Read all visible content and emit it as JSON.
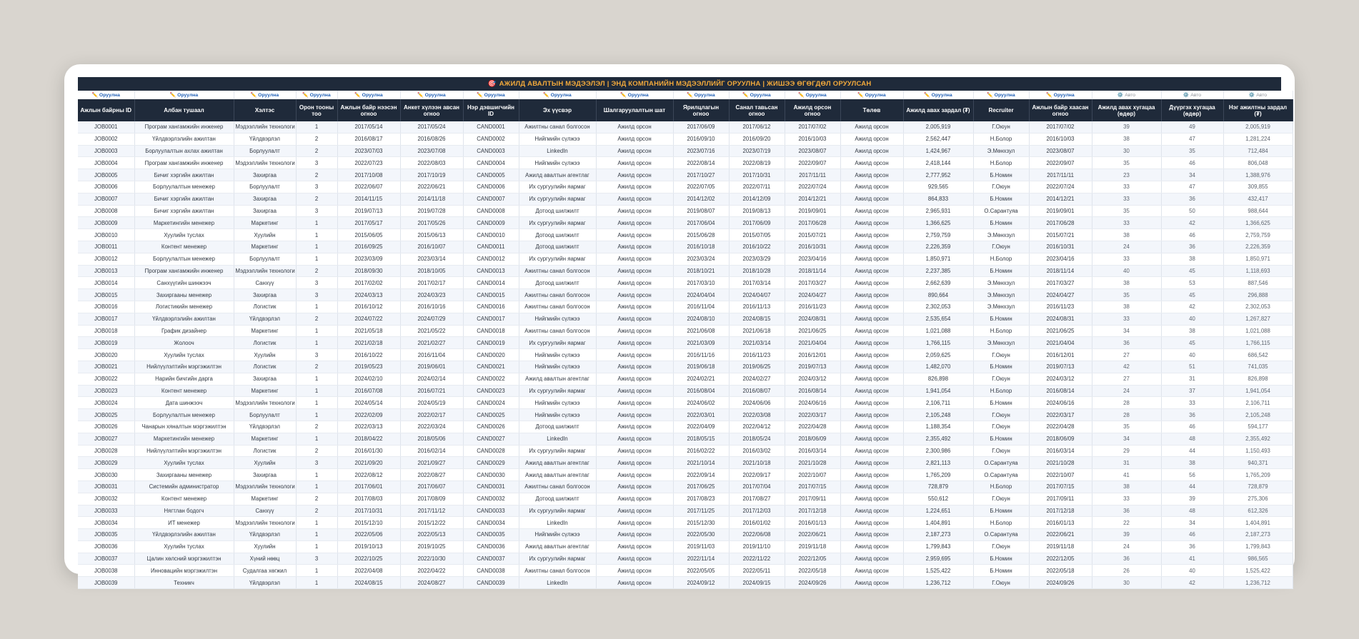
{
  "sheet": {
    "title": "АЖИЛД АВАЛТЫН МЭДЭЭЛЭЛ  |  ЭНД КОМПАНИЙН МЭДЭЭЛЛИЙГ ОРУУЛНА  |  ЖИШЭЭ ӨГӨГДӨЛ ОРУУЛСАН",
    "title_icon": "🎯",
    "input_marker": "✏️ Оруулна",
    "auto_marker": "⚙️ Авто",
    "colors": {
      "header_bg": "#1f2a3a",
      "title_text": "#f2a93b",
      "input_marker": "#1f5fb5",
      "row_stripe": "#f3f6fb"
    }
  },
  "columns": [
    {
      "label": "Ажлын байрны ID",
      "marker": "input",
      "w": 79
    },
    {
      "label": "Албан тушаал",
      "marker": "input",
      "w": 139
    },
    {
      "label": "Хэлтэс",
      "marker": "input",
      "w": 87
    },
    {
      "label": "Орон тооны тоо",
      "marker": "input",
      "w": 58
    },
    {
      "label": "Ажлын байр нээсэн огноо",
      "marker": "input",
      "w": 88
    },
    {
      "label": "Анкет хүлээн авсан огноо",
      "marker": "input",
      "w": 88
    },
    {
      "label": "Нэр дэвшигчийн ID",
      "marker": "input",
      "w": 78
    },
    {
      "label": "Эх үүсвэр",
      "marker": "input",
      "w": 108
    },
    {
      "label": "Шалгаруулалтын шат",
      "marker": "input",
      "w": 108
    },
    {
      "label": "Ярилцлагын огноо",
      "marker": "input",
      "w": 78
    },
    {
      "label": "Санал тавьсан огноо",
      "marker": "input",
      "w": 78
    },
    {
      "label": "Ажилд орсон огноо",
      "marker": "input",
      "w": 78
    },
    {
      "label": "Төлөв",
      "marker": "input",
      "w": 88
    },
    {
      "label": "Ажилд авах зардал (₮)",
      "marker": "input",
      "w": 98
    },
    {
      "label": "Recruiter",
      "marker": "input",
      "w": 78
    },
    {
      "label": "Ажлын байр хаасан огноо",
      "marker": "input",
      "w": 88
    },
    {
      "label": "Ажилд авах хугацаа (өдөр)",
      "marker": "auto",
      "w": 97
    },
    {
      "label": "Дүүргэх хугацаа (өдөр)",
      "marker": "auto",
      "w": 87
    },
    {
      "label": "Нэг ажилтны зардал (₮)",
      "marker": "auto",
      "w": 97
    }
  ],
  "rows": [
    [
      "JOB0001",
      "Програм хангамжийн инженер",
      "Мэдээллийн технологи",
      "1",
      "2017/05/14",
      "2017/05/24",
      "CAND0001",
      "Ажилтны санал болгосон",
      "Ажилд орсон",
      "2017/06/09",
      "2017/06/12",
      "2017/07/02",
      "Ажилд орсон",
      "2,005,919",
      "Г.Оюун",
      "2017/07/02",
      "39",
      "49",
      "2,005,919"
    ],
    [
      "JOB0002",
      "Үйлдвэрлэлийн ажилтан",
      "Үйлдвэрлэл",
      "2",
      "2016/08/17",
      "2016/08/26",
      "CAND0002",
      "Нийгмийн сүлжээ",
      "Ажилд орсон",
      "2016/09/10",
      "2016/09/20",
      "2016/10/03",
      "Ажилд орсон",
      "2,562,447",
      "Н.Болор",
      "2016/10/03",
      "38",
      "47",
      "1,281,224"
    ],
    [
      "JOB0003",
      "Борлуулалтын ахлах ажилтан",
      "Борлуулалт",
      "2",
      "2023/07/03",
      "2023/07/08",
      "CAND0003",
      "LinkedIn",
      "Ажилд орсон",
      "2023/07/16",
      "2023/07/19",
      "2023/08/07",
      "Ажилд орсон",
      "1,424,967",
      "Э.Мөнхзул",
      "2023/08/07",
      "30",
      "35",
      "712,484"
    ],
    [
      "JOB0004",
      "Програм хангамжийн инженер",
      "Мэдээллийн технологи",
      "3",
      "2022/07/23",
      "2022/08/03",
      "CAND0004",
      "Нийгмийн сүлжээ",
      "Ажилд орсон",
      "2022/08/14",
      "2022/08/19",
      "2022/09/07",
      "Ажилд орсон",
      "2,418,144",
      "Н.Болор",
      "2022/09/07",
      "35",
      "46",
      "806,048"
    ],
    [
      "JOB0005",
      "Бичиг хэргийн ажилтан",
      "Захиргаа",
      "2",
      "2017/10/08",
      "2017/10/19",
      "CAND0005",
      "Ажилд авалтын агентлаг",
      "Ажилд орсон",
      "2017/10/27",
      "2017/10/31",
      "2017/11/11",
      "Ажилд орсон",
      "2,777,952",
      "Б.Номин",
      "2017/11/11",
      "23",
      "34",
      "1,388,976"
    ],
    [
      "JOB0006",
      "Борлуулалтын менежер",
      "Борлуулалт",
      "3",
      "2022/06/07",
      "2022/06/21",
      "CAND0006",
      "Их сургуулийн яармаг",
      "Ажилд орсон",
      "2022/07/05",
      "2022/07/11",
      "2022/07/24",
      "Ажилд орсон",
      "929,565",
      "Г.Оюун",
      "2022/07/24",
      "33",
      "47",
      "309,855"
    ],
    [
      "JOB0007",
      "Бичиг хэргийн ажилтан",
      "Захиргаа",
      "2",
      "2014/11/15",
      "2014/11/18",
      "CAND0007",
      "Их сургуулийн яармаг",
      "Ажилд орсон",
      "2014/12/02",
      "2014/12/09",
      "2014/12/21",
      "Ажилд орсон",
      "864,833",
      "Б.Номин",
      "2014/12/21",
      "33",
      "36",
      "432,417"
    ],
    [
      "JOB0008",
      "Бичиг хэргийн ажилтан",
      "Захиргаа",
      "3",
      "2019/07/13",
      "2019/07/28",
      "CAND0008",
      "Дотоод шилжилт",
      "Ажилд орсон",
      "2019/08/07",
      "2019/08/13",
      "2019/09/01",
      "Ажилд орсон",
      "2,965,931",
      "О.Сарантуяа",
      "2019/09/01",
      "35",
      "50",
      "988,644"
    ],
    [
      "JOB0009",
      "Маркетингийн менежер",
      "Маркетинг",
      "1",
      "2017/05/17",
      "2017/05/26",
      "CAND0009",
      "Их сургуулийн яармаг",
      "Ажилд орсон",
      "2017/06/04",
      "2017/06/09",
      "2017/06/28",
      "Ажилд орсон",
      "1,366,625",
      "Б.Номин",
      "2017/06/28",
      "33",
      "42",
      "1,366,625"
    ],
    [
      "JOB0010",
      "Хуулийн туслах",
      "Хуулийн",
      "1",
      "2015/06/05",
      "2015/06/13",
      "CAND0010",
      "Дотоод шилжилт",
      "Ажилд орсон",
      "2015/06/28",
      "2015/07/05",
      "2015/07/21",
      "Ажилд орсон",
      "2,759,759",
      "Э.Мөнхзул",
      "2015/07/21",
      "38",
      "46",
      "2,759,759"
    ],
    [
      "JOB0011",
      "Контент менежер",
      "Маркетинг",
      "1",
      "2016/09/25",
      "2016/10/07",
      "CAND0011",
      "Дотоод шилжилт",
      "Ажилд орсон",
      "2016/10/18",
      "2016/10/22",
      "2016/10/31",
      "Ажилд орсон",
      "2,226,359",
      "Г.Оюун",
      "2016/10/31",
      "24",
      "36",
      "2,226,359"
    ],
    [
      "JOB0012",
      "Борлуулалтын менежер",
      "Борлуулалт",
      "1",
      "2023/03/09",
      "2023/03/14",
      "CAND0012",
      "Их сургуулийн яармаг",
      "Ажилд орсон",
      "2023/03/24",
      "2023/03/29",
      "2023/04/16",
      "Ажилд орсон",
      "1,850,971",
      "Н.Болор",
      "2023/04/16",
      "33",
      "38",
      "1,850,971"
    ],
    [
      "JOB0013",
      "Програм хангамжийн инженер",
      "Мэдээллийн технологи",
      "2",
      "2018/09/30",
      "2018/10/05",
      "CAND0013",
      "Ажилтны санал болгосон",
      "Ажилд орсон",
      "2018/10/21",
      "2018/10/28",
      "2018/11/14",
      "Ажилд орсон",
      "2,237,385",
      "Б.Номин",
      "2018/11/14",
      "40",
      "45",
      "1,118,693"
    ],
    [
      "JOB0014",
      "Санхүүгийн шинжээч",
      "Санхүү",
      "3",
      "2017/02/02",
      "2017/02/17",
      "CAND0014",
      "Дотоод шилжилт",
      "Ажилд орсон",
      "2017/03/10",
      "2017/03/14",
      "2017/03/27",
      "Ажилд орсон",
      "2,662,639",
      "Э.Мөнхзул",
      "2017/03/27",
      "38",
      "53",
      "887,546"
    ],
    [
      "JOB0015",
      "Захиргааны менежер",
      "Захиргаа",
      "3",
      "2024/03/13",
      "2024/03/23",
      "CAND0015",
      "Ажилтны санал болгосон",
      "Ажилд орсон",
      "2024/04/04",
      "2024/04/07",
      "2024/04/27",
      "Ажилд орсон",
      "890,664",
      "Э.Мөнхзул",
      "2024/04/27",
      "35",
      "45",
      "296,888"
    ],
    [
      "JOB0016",
      "Логистикийн менежер",
      "Логистик",
      "1",
      "2016/10/12",
      "2016/10/16",
      "CAND0016",
      "Ажилтны санал болгосон",
      "Ажилд орсон",
      "2016/11/04",
      "2016/11/13",
      "2016/11/23",
      "Ажилд орсон",
      "2,302,053",
      "Э.Мөнхзул",
      "2016/11/23",
      "38",
      "42",
      "2,302,053"
    ],
    [
      "JOB0017",
      "Үйлдвэрлэлийн ажилтан",
      "Үйлдвэрлэл",
      "2",
      "2024/07/22",
      "2024/07/29",
      "CAND0017",
      "Нийгмийн сүлжээ",
      "Ажилд орсон",
      "2024/08/10",
      "2024/08/15",
      "2024/08/31",
      "Ажилд орсон",
      "2,535,654",
      "Б.Номин",
      "2024/08/31",
      "33",
      "40",
      "1,267,827"
    ],
    [
      "JOB0018",
      "График дизайнер",
      "Маркетинг",
      "1",
      "2021/05/18",
      "2021/05/22",
      "CAND0018",
      "Ажилтны санал болгосон",
      "Ажилд орсон",
      "2021/06/08",
      "2021/06/18",
      "2021/06/25",
      "Ажилд орсон",
      "1,021,088",
      "Н.Болор",
      "2021/06/25",
      "34",
      "38",
      "1,021,088"
    ],
    [
      "JOB0019",
      "Жолооч",
      "Логистик",
      "1",
      "2021/02/18",
      "2021/02/27",
      "CAND0019",
      "Их сургуулийн яармаг",
      "Ажилд орсон",
      "2021/03/09",
      "2021/03/14",
      "2021/04/04",
      "Ажилд орсон",
      "1,766,115",
      "Э.Мөнхзул",
      "2021/04/04",
      "36",
      "45",
      "1,766,115"
    ],
    [
      "JOB0020",
      "Хуулийн туслах",
      "Хуулийн",
      "3",
      "2016/10/22",
      "2016/11/04",
      "CAND0020",
      "Нийгмийн сүлжээ",
      "Ажилд орсон",
      "2016/11/16",
      "2016/11/23",
      "2016/12/01",
      "Ажилд орсон",
      "2,059,625",
      "Г.Оюун",
      "2016/12/01",
      "27",
      "40",
      "686,542"
    ],
    [
      "JOB0021",
      "Нийлүүлэлтийн мэргэжилтэн",
      "Логистик",
      "2",
      "2019/05/23",
      "2019/06/01",
      "CAND0021",
      "Нийгмийн сүлжээ",
      "Ажилд орсон",
      "2019/06/18",
      "2019/06/25",
      "2019/07/13",
      "Ажилд орсон",
      "1,482,070",
      "Б.Номин",
      "2019/07/13",
      "42",
      "51",
      "741,035"
    ],
    [
      "JOB0022",
      "Нарийн бичгийн дарга",
      "Захиргаа",
      "1",
      "2024/02/10",
      "2024/02/14",
      "CAND0022",
      "Ажилд авалтын агентлаг",
      "Ажилд орсон",
      "2024/02/21",
      "2024/02/27",
      "2024/03/12",
      "Ажилд орсон",
      "826,898",
      "Г.Оюун",
      "2024/03/12",
      "27",
      "31",
      "826,898"
    ],
    [
      "JOB0023",
      "Контент менежер",
      "Маркетинг",
      "1",
      "2016/07/08",
      "2016/07/21",
      "CAND0023",
      "Их сургуулийн яармаг",
      "Ажилд орсон",
      "2016/08/04",
      "2016/08/07",
      "2016/08/14",
      "Ажилд орсон",
      "1,941,054",
      "Н.Болор",
      "2016/08/14",
      "24",
      "37",
      "1,941,054"
    ],
    [
      "JOB0024",
      "Дата шинжээч",
      "Мэдээллийн технологи",
      "1",
      "2024/05/14",
      "2024/05/19",
      "CAND0024",
      "Нийгмийн сүлжээ",
      "Ажилд орсон",
      "2024/06/02",
      "2024/06/06",
      "2024/06/16",
      "Ажилд орсон",
      "2,106,711",
      "Б.Номин",
      "2024/06/16",
      "28",
      "33",
      "2,106,711"
    ],
    [
      "JOB0025",
      "Борлуулалтын менежер",
      "Борлуулалт",
      "1",
      "2022/02/09",
      "2022/02/17",
      "CAND0025",
      "Нийгмийн сүлжээ",
      "Ажилд орсон",
      "2022/03/01",
      "2022/03/08",
      "2022/03/17",
      "Ажилд орсон",
      "2,105,248",
      "Г.Оюун",
      "2022/03/17",
      "28",
      "36",
      "2,105,248"
    ],
    [
      "JOB0026",
      "Чанарын хяналтын мэргэжилтэн",
      "Үйлдвэрлэл",
      "2",
      "2022/03/13",
      "2022/03/24",
      "CAND0026",
      "Дотоод шилжилт",
      "Ажилд орсон",
      "2022/04/09",
      "2022/04/12",
      "2022/04/28",
      "Ажилд орсон",
      "1,188,354",
      "Г.Оюун",
      "2022/04/28",
      "35",
      "46",
      "594,177"
    ],
    [
      "JOB0027",
      "Маркетингийн менежер",
      "Маркетинг",
      "1",
      "2018/04/22",
      "2018/05/06",
      "CAND0027",
      "LinkedIn",
      "Ажилд орсон",
      "2018/05/15",
      "2018/05/24",
      "2018/06/09",
      "Ажилд орсон",
      "2,355,492",
      "Б.Номин",
      "2018/06/09",
      "34",
      "48",
      "2,355,492"
    ],
    [
      "JOB0028",
      "Нийлүүлэлтийн мэргэжилтэн",
      "Логистик",
      "2",
      "2016/01/30",
      "2016/02/14",
      "CAND0028",
      "Их сургуулийн яармаг",
      "Ажилд орсон",
      "2016/02/22",
      "2016/03/02",
      "2016/03/14",
      "Ажилд орсон",
      "2,300,986",
      "Г.Оюун",
      "2016/03/14",
      "29",
      "44",
      "1,150,493"
    ],
    [
      "JOB0029",
      "Хуулийн туслах",
      "Хуулийн",
      "3",
      "2021/09/20",
      "2021/09/27",
      "CAND0029",
      "Ажилд авалтын агентлаг",
      "Ажилд орсон",
      "2021/10/14",
      "2021/10/18",
      "2021/10/28",
      "Ажилд орсон",
      "2,821,113",
      "О.Сарантуяа",
      "2021/10/28",
      "31",
      "38",
      "940,371"
    ],
    [
      "JOB0030",
      "Захиргааны менежер",
      "Захиргаа",
      "1",
      "2022/08/12",
      "2022/08/27",
      "CAND0030",
      "Ажилд авалтын агентлаг",
      "Ажилд орсон",
      "2022/09/14",
      "2022/09/17",
      "2022/10/07",
      "Ажилд орсон",
      "1,765,209",
      "О.Сарантуяа",
      "2022/10/07",
      "41",
      "56",
      "1,765,209"
    ],
    [
      "JOB0031",
      "Системийн администратор",
      "Мэдээллийн технологи",
      "1",
      "2017/06/01",
      "2017/06/07",
      "CAND0031",
      "Ажилтны санал болгосон",
      "Ажилд орсон",
      "2017/06/25",
      "2017/07/04",
      "2017/07/15",
      "Ажилд орсон",
      "728,879",
      "Н.Болор",
      "2017/07/15",
      "38",
      "44",
      "728,879"
    ],
    [
      "JOB0032",
      "Контент менежер",
      "Маркетинг",
      "2",
      "2017/08/03",
      "2017/08/09",
      "CAND0032",
      "Дотоод шилжилт",
      "Ажилд орсон",
      "2017/08/23",
      "2017/08/27",
      "2017/09/11",
      "Ажилд орсон",
      "550,612",
      "Г.Оюун",
      "2017/09/11",
      "33",
      "39",
      "275,306"
    ],
    [
      "JOB0033",
      "Нягтлан бодогч",
      "Санхүү",
      "2",
      "2017/10/31",
      "2017/11/12",
      "CAND0033",
      "Их сургуулийн яармаг",
      "Ажилд орсон",
      "2017/11/25",
      "2017/12/03",
      "2017/12/18",
      "Ажилд орсон",
      "1,224,651",
      "Б.Номин",
      "2017/12/18",
      "36",
      "48",
      "612,326"
    ],
    [
      "JOB0034",
      "ИТ менежер",
      "Мэдээллийн технологи",
      "1",
      "2015/12/10",
      "2015/12/22",
      "CAND0034",
      "LinkedIn",
      "Ажилд орсон",
      "2015/12/30",
      "2016/01/02",
      "2016/01/13",
      "Ажилд орсон",
      "1,404,891",
      "Н.Болор",
      "2016/01/13",
      "22",
      "34",
      "1,404,891"
    ],
    [
      "JOB0035",
      "Үйлдвэрлэлийн ажилтан",
      "Үйлдвэрлэл",
      "1",
      "2022/05/06",
      "2022/05/13",
      "CAND0035",
      "Нийгмийн сүлжээ",
      "Ажилд орсон",
      "2022/05/30",
      "2022/06/08",
      "2022/06/21",
      "Ажилд орсон",
      "2,187,273",
      "О.Сарантуяа",
      "2022/06/21",
      "39",
      "46",
      "2,187,273"
    ],
    [
      "JOB0036",
      "Хуулийн туслах",
      "Хуулийн",
      "1",
      "2019/10/13",
      "2019/10/25",
      "CAND0036",
      "Ажилд авалтын агентлаг",
      "Ажилд орсон",
      "2019/11/03",
      "2019/11/10",
      "2019/11/18",
      "Ажилд орсон",
      "1,799,843",
      "Г.Оюун",
      "2019/11/18",
      "24",
      "36",
      "1,799,843"
    ],
    [
      "JOB0037",
      "Цалин хөлсний мэргэжилтэн",
      "Хүний нөөц",
      "3",
      "2022/10/25",
      "2022/10/30",
      "CAND0037",
      "Их сургуулийн яармаг",
      "Ажилд орсон",
      "2022/11/14",
      "2022/11/22",
      "2022/12/05",
      "Ажилд орсон",
      "2,959,695",
      "Б.Номин",
      "2022/12/05",
      "36",
      "41",
      "986,565"
    ],
    [
      "JOB0038",
      "Инновацийн мэргэжилтэн",
      "Судалгаа хөгжил",
      "1",
      "2022/04/08",
      "2022/04/22",
      "CAND0038",
      "Ажилтны санал болгосон",
      "Ажилд орсон",
      "2022/05/05",
      "2022/05/11",
      "2022/05/18",
      "Ажилд орсон",
      "1,525,422",
      "Б.Номин",
      "2022/05/18",
      "26",
      "40",
      "1,525,422"
    ],
    [
      "JOB0039",
      "Техникч",
      "Үйлдвэрлэл",
      "1",
      "2024/08/15",
      "2024/08/27",
      "CAND0039",
      "LinkedIn",
      "Ажилд орсон",
      "2024/09/12",
      "2024/09/15",
      "2024/09/26",
      "Ажилд орсон",
      "1,236,712",
      "Г.Оюун",
      "2024/09/26",
      "30",
      "42",
      "1,236,712"
    ]
  ]
}
